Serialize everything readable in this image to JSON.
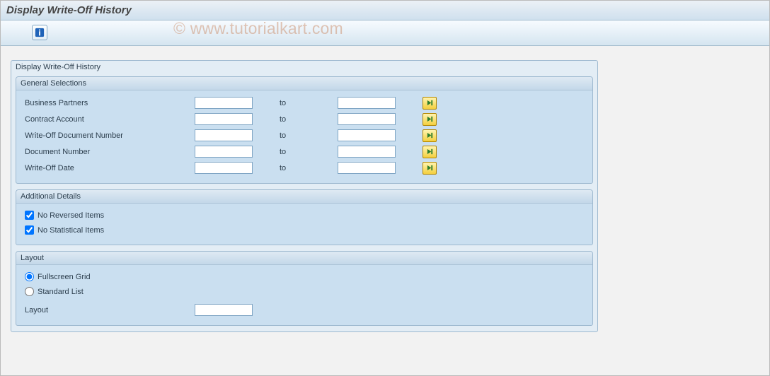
{
  "title": "Display Write-Off History",
  "watermark": "© www.tutorialkart.com",
  "mainGroup": {
    "title": "Display Write-Off History"
  },
  "general": {
    "title": "General Selections",
    "toLabel": "to",
    "rows": {
      "bp": {
        "label": "Business Partners",
        "from": "",
        "to": ""
      },
      "ca": {
        "label": "Contract Account",
        "from": "",
        "to": ""
      },
      "wdn": {
        "label": "Write-Off Document Number",
        "from": "",
        "to": ""
      },
      "dn": {
        "label": "Document Number",
        "from": "",
        "to": ""
      },
      "wd": {
        "label": "Write-Off Date",
        "from": "",
        "to": ""
      }
    }
  },
  "additional": {
    "title": "Additional Details",
    "noReversed": {
      "label": "No Reversed Items",
      "checked": true
    },
    "noStatistical": {
      "label": "No Statistical Items",
      "checked": true
    }
  },
  "layout": {
    "title": "Layout",
    "fullscreen": {
      "label": "Fullscreen Grid",
      "selected": true
    },
    "standard": {
      "label": "Standard List",
      "selected": false
    },
    "layoutField": {
      "label": "Layout",
      "value": ""
    }
  }
}
